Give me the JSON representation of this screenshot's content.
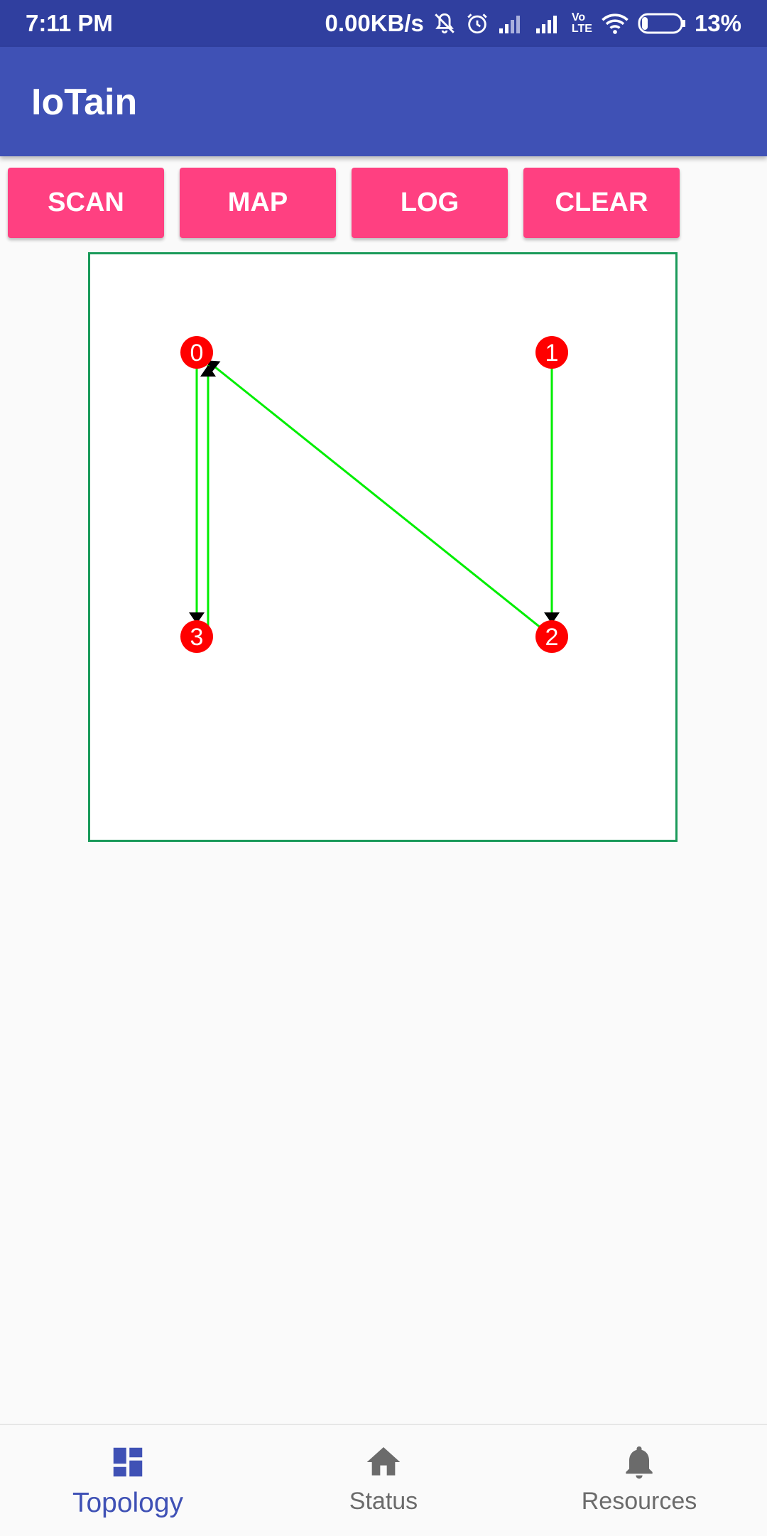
{
  "status_bar": {
    "time": "7:11 PM",
    "net_speed": "0.00KB/s",
    "battery": "13%",
    "icons": [
      "mute-bell-icon",
      "alarm-icon",
      "signal-icon",
      "signal-icon",
      "volte-icon",
      "wifi-icon",
      "battery-icon"
    ],
    "volte_text_top": "Vo",
    "volte_text_bottom": "LTE"
  },
  "app_bar": {
    "title": "IoTain"
  },
  "toolbar": {
    "scan_label": "SCAN",
    "map_label": "MAP",
    "log_label": "LOG",
    "clear_label": "CLEAR"
  },
  "topology": {
    "nodes": [
      {
        "id": "0",
        "col": 0,
        "row": 0
      },
      {
        "id": "1",
        "col": 1,
        "row": 0
      },
      {
        "id": "2",
        "col": 1,
        "row": 1
      },
      {
        "id": "3",
        "col": 0,
        "row": 1
      }
    ],
    "links": [
      {
        "from": "0",
        "to": "3"
      },
      {
        "from": "1",
        "to": "2"
      },
      {
        "from": "2",
        "to": "0"
      },
      {
        "from": "3",
        "to": "0"
      }
    ],
    "node_color": "#ff0000",
    "link_color": "#00ee00",
    "border_color": "#1a9a5a"
  },
  "bottom_nav": {
    "items": [
      {
        "label": "Topology",
        "icon": "dashboard-icon",
        "active": true
      },
      {
        "label": "Status",
        "icon": "home-icon",
        "active": false
      },
      {
        "label": "Resources",
        "icon": "bell-icon",
        "active": false
      }
    ]
  },
  "colors": {
    "primary": "#3f51b5",
    "primary_dark": "#303f9f",
    "accent": "#ff4081"
  }
}
